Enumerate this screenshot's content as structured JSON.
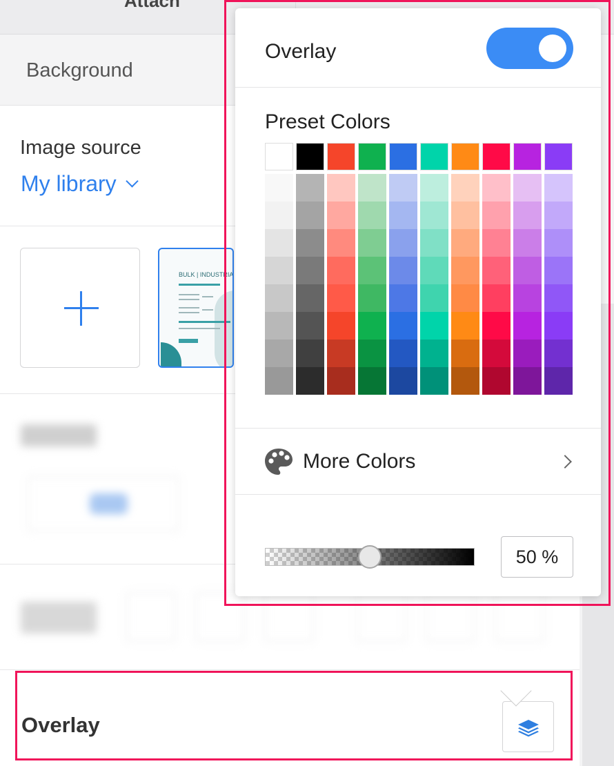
{
  "topbar": {
    "crumb_text": "Attach"
  },
  "tabs": {
    "background_label": "Background"
  },
  "image_source": {
    "label": "Image source",
    "value": "My library"
  },
  "thumbnail": {
    "title": "BULK | INDUSTRIAL ORDER"
  },
  "overlay_section": {
    "label": "Overlay"
  },
  "popup": {
    "overlay_label": "Overlay",
    "overlay_enabled": true,
    "preset_label": "Preset Colors",
    "more_colors_label": "More Colors",
    "opacity_value": "50 %"
  },
  "colors": {
    "accent": "#3b8cf5",
    "highlight": "#f0145a",
    "top_row": [
      "#ffffff",
      "#000000",
      "#f5452a",
      "#0fb14f",
      "#2b6fe3",
      "#00d4aa",
      "#ff8a15",
      "#ff0a47",
      "#b723e0",
      "#8a3cf6"
    ],
    "columns": [
      [
        "#f8f8f8",
        "#f2f2f2",
        "#e4e4e4",
        "#d6d6d6",
        "#c8c8c8",
        "#b8b8b8",
        "#a8a8a8",
        "#999999"
      ],
      [
        "#b4b4b4",
        "#a4a4a4",
        "#8c8c8c",
        "#7a7a7a",
        "#666666",
        "#545454",
        "#404040",
        "#2c2c2c"
      ],
      [
        "#ffc7c0",
        "#ffa8a0",
        "#ff8a7e",
        "#ff6b5e",
        "#ff5a48",
        "#f5452a",
        "#c83a24",
        "#a82d1e"
      ],
      [
        "#bfe4c9",
        "#9fd9ae",
        "#7fcd92",
        "#5cc277",
        "#3fb863",
        "#0fb14f",
        "#0a9342",
        "#067635"
      ],
      [
        "#bfcbf4",
        "#a4b7f1",
        "#8aa1ed",
        "#6c8ae9",
        "#4d78e6",
        "#2b6fe3",
        "#2358c2",
        "#1c48a0"
      ],
      [
        "#bdeede",
        "#9fe7d3",
        "#80e0c6",
        "#5fdab9",
        "#3fd4ae",
        "#00d4aa",
        "#00b28f",
        "#009179"
      ],
      [
        "#ffd2bc",
        "#ffc0a0",
        "#ffaa7e",
        "#ff985f",
        "#ff8a45",
        "#ff8a15",
        "#d96c10",
        "#b3580d"
      ],
      [
        "#ffbfc9",
        "#ffa1ad",
        "#ff8193",
        "#ff6179",
        "#ff3f60",
        "#ff0a47",
        "#d40a3b",
        "#b0072f"
      ],
      [
        "#e6bff3",
        "#d89eee",
        "#cb7ee8",
        "#bf5ee3",
        "#b843e0",
        "#b723e0",
        "#9a1cbd",
        "#7e169a"
      ],
      [
        "#d5c4fc",
        "#c2a9fa",
        "#ae8ff9",
        "#9b74f8",
        "#9057f7",
        "#8a3cf6",
        "#7330d0",
        "#5e26aa"
      ]
    ]
  }
}
